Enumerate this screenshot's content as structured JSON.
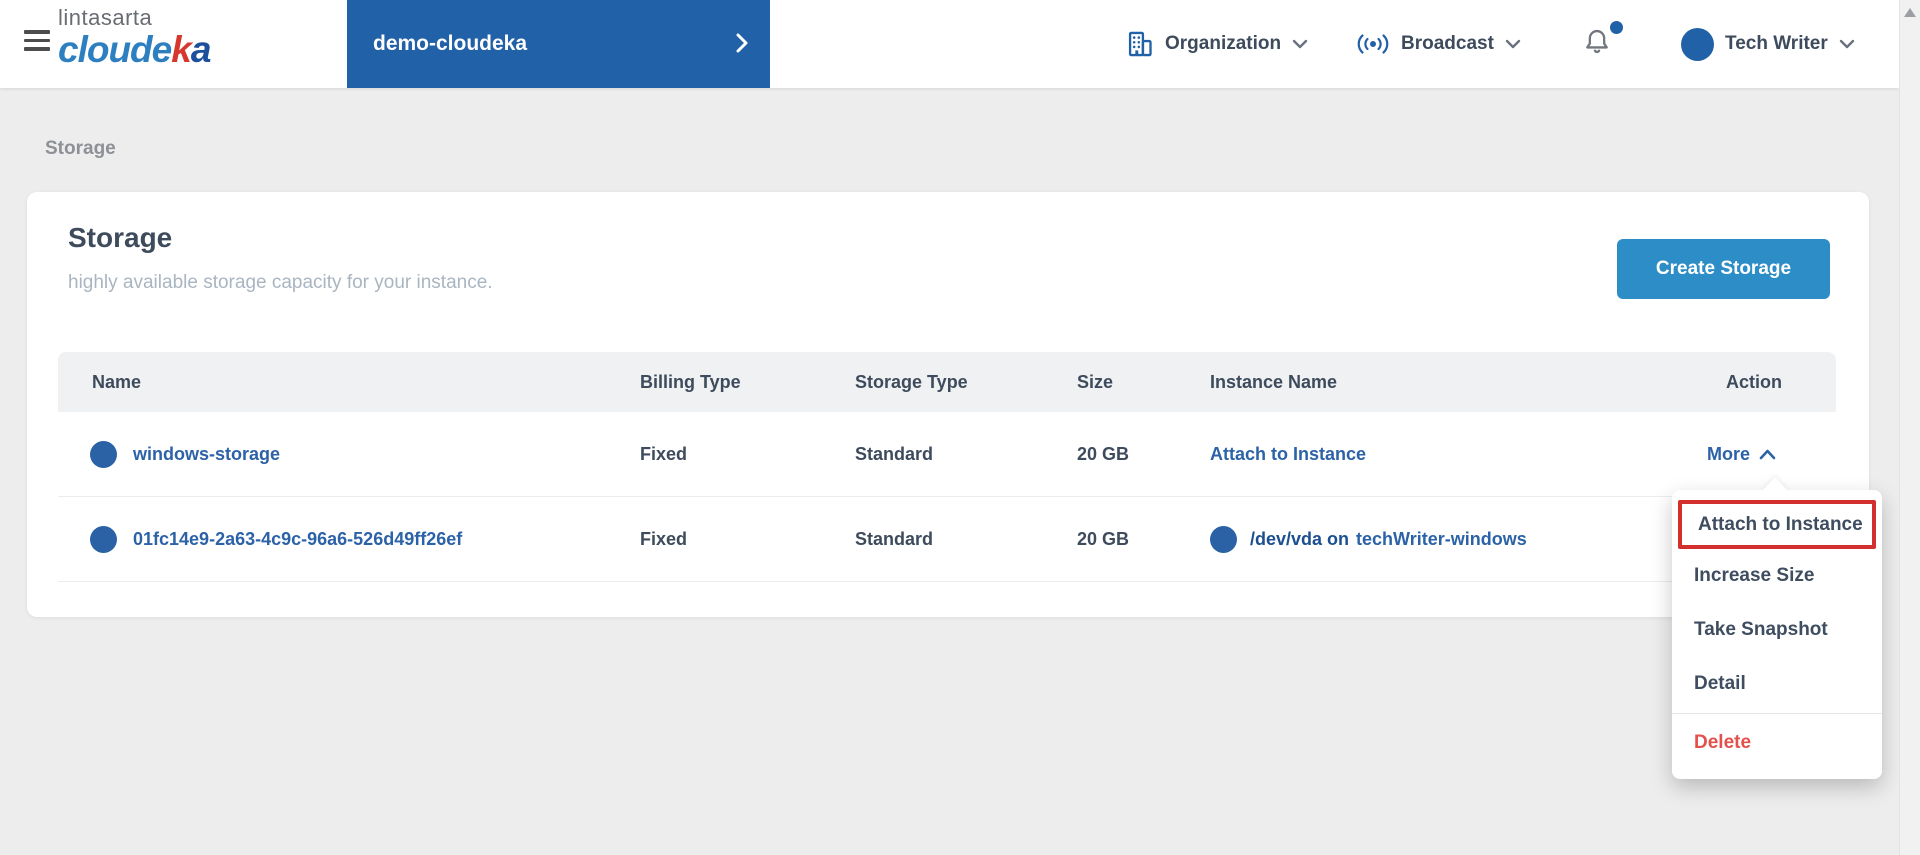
{
  "header": {
    "logo": {
      "top": "lintasarta",
      "brand_part1": "cloude",
      "brand_part2": "k",
      "brand_part3": "a"
    },
    "project": {
      "label": "demo-cloudeka"
    },
    "nav": {
      "organization": "Organization",
      "broadcast": "Broadcast"
    },
    "user": {
      "name": "Tech Writer"
    }
  },
  "breadcrumb": {
    "label": "Storage"
  },
  "main": {
    "title": "Storage",
    "subtitle": "highly available storage capacity for your instance.",
    "create_button": "Create Storage"
  },
  "table": {
    "columns": [
      "Name",
      "Billing Type",
      "Storage Type",
      "Size",
      "Instance Name",
      "Action"
    ],
    "rows": [
      {
        "name": "windows-storage",
        "billing": "Fixed",
        "storage": "Standard",
        "size": "20 GB",
        "instance_action": "Attach to Instance",
        "more": "More"
      },
      {
        "name": "01fc14e9-2a63-4c9c-96a6-526d49ff26ef",
        "billing": "Fixed",
        "storage": "Standard",
        "size": "20 GB",
        "device": "/dev/vda on",
        "instance": "techWriter-windows"
      }
    ]
  },
  "dropdown": {
    "items": [
      {
        "label": "Attach to Instance",
        "highlighted": true
      },
      {
        "label": "Increase Size"
      },
      {
        "label": "Take Snapshot"
      },
      {
        "label": "Detail"
      },
      {
        "label": "Delete",
        "danger": true
      }
    ]
  },
  "colors": {
    "brand_blue": "#2161a7",
    "link_blue": "#2c62a7",
    "button_blue": "#2d8dc7",
    "danger_red": "#e2514b",
    "highlight_red": "#d32f2f",
    "page_background": "#ededee"
  }
}
